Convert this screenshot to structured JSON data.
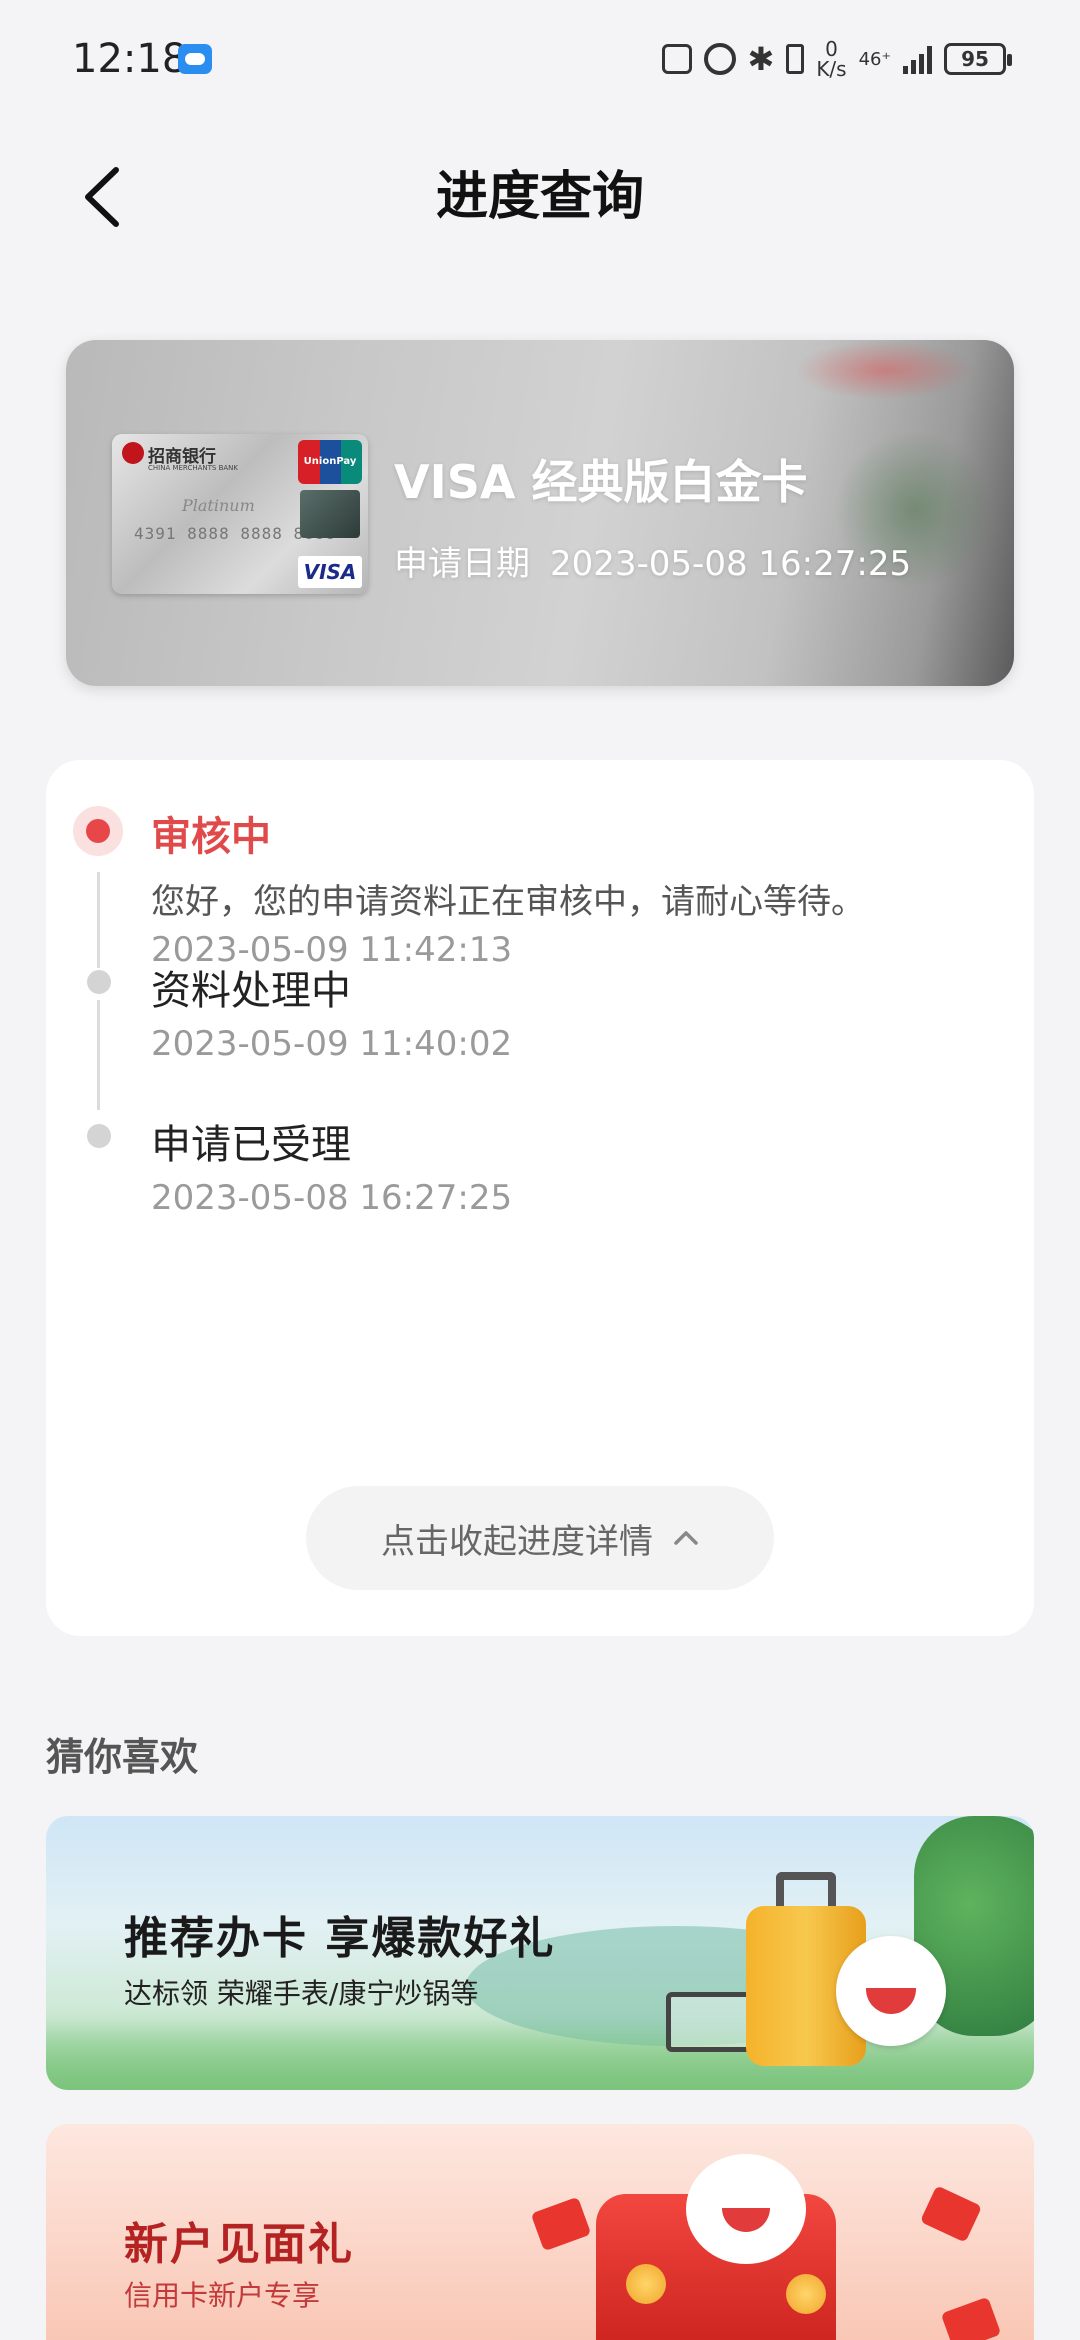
{
  "status_bar": {
    "time": "12:18",
    "speed_value": "0",
    "speed_unit": "K/s",
    "network": "46⁺",
    "battery": "95"
  },
  "header": {
    "title": "进度查询"
  },
  "card": {
    "name": "VISA 经典版白金卡",
    "date_label": "申请日期",
    "date_value": "2023-05-08 16:27:25",
    "image": {
      "bank_name": "招商银行",
      "bank_name_en": "CHINA MERCHANTS BANK",
      "tier": "Platinum",
      "number": "4391 8888 8888 8888",
      "network_logo": "UnionPay 银联",
      "brand": "VISA"
    }
  },
  "progress": {
    "steps": [
      {
        "title": "审核中",
        "desc": "您好，您的申请资料正在审核中，请耐心等待。",
        "time": "2023-05-09 11:42:13",
        "active": true
      },
      {
        "title": "资料处理中",
        "time": "2023-05-09 11:40:02",
        "active": false
      },
      {
        "title": "申请已受理",
        "time": "2023-05-08 16:27:25",
        "active": false
      }
    ],
    "collapse_label": "点击收起进度详情"
  },
  "recommend": {
    "title": "猜你喜欢",
    "banners": [
      {
        "headline": "推荐办卡 享爆款好礼",
        "subtitle": "达标领 荣耀手表/康宁炒锅等"
      },
      {
        "headline": "新户见面礼",
        "subtitle": "信用卡新户专享"
      }
    ]
  },
  "colors": {
    "accent_red": "#e8474a",
    "background": "#f4f4f6",
    "panel": "#ffffff"
  }
}
